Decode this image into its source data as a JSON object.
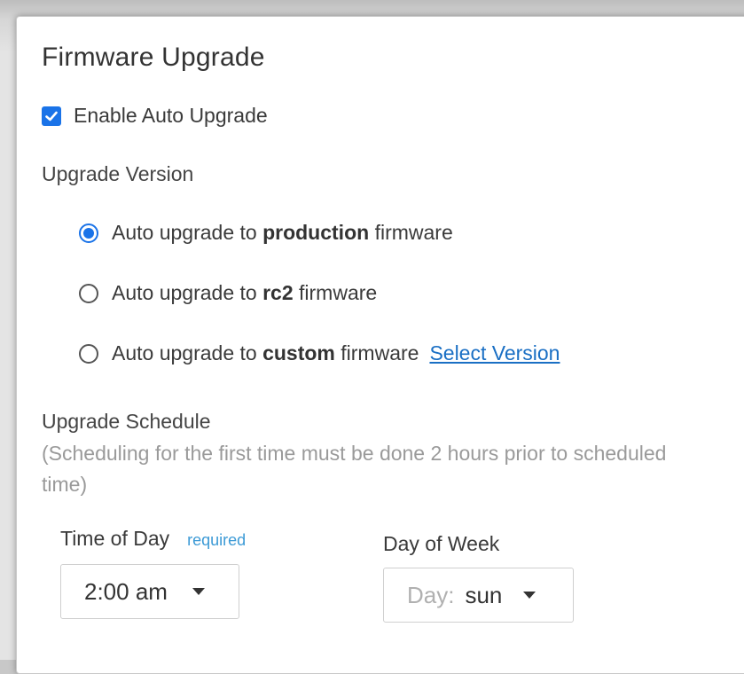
{
  "title": "Firmware Upgrade",
  "auto_upgrade": {
    "label": "Enable Auto Upgrade",
    "checked": true
  },
  "upgrade_version": {
    "heading": "Upgrade Version",
    "options": [
      {
        "prefix": "Auto upgrade to",
        "bold": "production",
        "suffix": "firmware",
        "selected": true
      },
      {
        "prefix": "Auto upgrade to",
        "bold": "rc2",
        "suffix": "firmware",
        "selected": false
      },
      {
        "prefix": "Auto upgrade to",
        "bold": "custom",
        "suffix": "firmware",
        "selected": false
      }
    ],
    "select_version_link": "Select Version"
  },
  "schedule": {
    "heading": "Upgrade Schedule",
    "note": "(Scheduling for the first time must be done 2 hours prior to scheduled time)",
    "time_of_day": {
      "label": "Time of Day",
      "required": "required",
      "value": "2:00 am"
    },
    "day_of_week": {
      "label": "Day of Week",
      "prefix": "Day:",
      "value": "sun"
    }
  },
  "colors": {
    "accent": "#1a73e8",
    "link": "#1a6fc4",
    "required": "#3c9ad6",
    "note": "#9a9a9a"
  }
}
